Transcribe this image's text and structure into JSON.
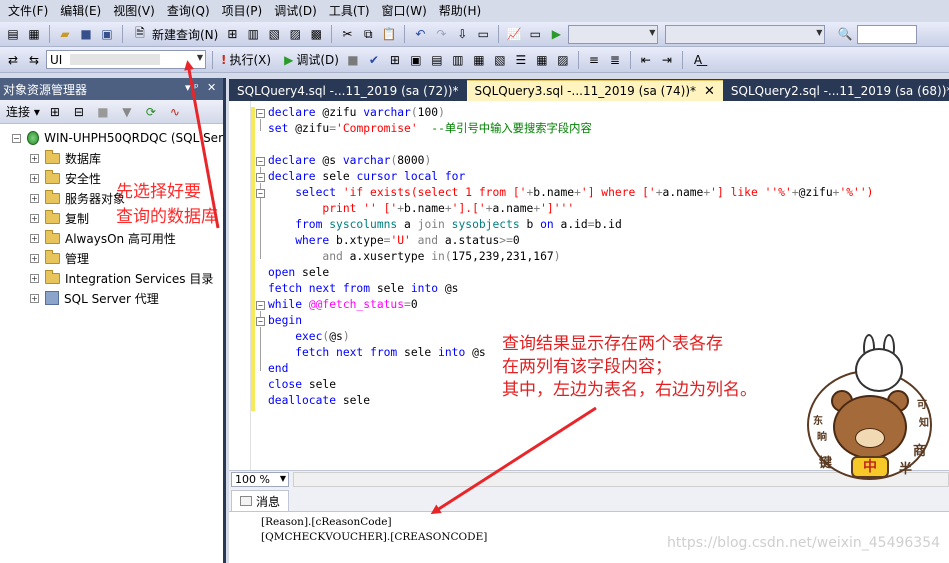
{
  "menu": [
    "文件(F)",
    "编辑(E)",
    "视图(V)",
    "查询(Q)",
    "项目(P)",
    "调试(D)",
    "工具(T)",
    "窗口(W)",
    "帮助(H)"
  ],
  "toolbar": {
    "new_query": "新建查询(N)",
    "database_combo": "UI",
    "execute": "执行(X)",
    "debug": "调试(D)"
  },
  "object_explorer": {
    "title": "对象资源管理器",
    "pin": "▾ ᵖ",
    "close": "✕",
    "connect": "连接",
    "server": "WIN-UHPH50QRDQC (SQL Ser",
    "nodes": [
      "数据库",
      "安全性",
      "服务器对象",
      "复制",
      "AlwaysOn 高可用性",
      "管理",
      "Integration Services 目录",
      "SQL Server 代理"
    ]
  },
  "tabs": [
    {
      "label": "SQLQuery4.sql -...11_2019 (sa (72))*"
    },
    {
      "label": "SQLQuery3.sql -...11_2019 (sa (74))*",
      "close": "✕"
    },
    {
      "label": "SQLQuery2.sql -...11_2019 (sa (68))*"
    }
  ],
  "code": {
    "l1a": "declare ",
    "l1b": "@zifu ",
    "l1c": "varchar",
    "l1d": "(",
    "l1e": "100",
    "l1f": ")",
    "l2a": "set ",
    "l2b": "@zifu",
    "l2c": "=",
    "l2d": "'Compromise'",
    "l2e": "  --单引号中输入要搜索字段内容",
    "l3a": "declare ",
    "l3b": "@s ",
    "l3c": "varchar",
    "l3d": "(",
    "l3e": "8000",
    "l3f": ")",
    "l4a": "declare ",
    "l4b": "sele ",
    "l4c": "cursor local for",
    "l5a": "    select ",
    "l5b": "'if exists(select 1 from ['",
    "l5c": "+",
    "l5d": "b.name",
    "l5e": "+",
    "l5f": "'] where ['",
    "l5g": "+",
    "l5h": "a.name",
    "l5i": "+",
    "l5j": "'] like ''%'",
    "l5k": "+",
    "l5l": "@zifu",
    "l5m": "+",
    "l5n": "'%'')",
    "l6a": "        print '' ['",
    "l6b": "+",
    "l6c": "b.name",
    "l6d": "+",
    "l6e": "'].['",
    "l6f": "+",
    "l6g": "a.name",
    "l6h": "+",
    "l6i": "']'''",
    "l7a": "    from ",
    "l7b": "syscolumns ",
    "l7c": "a ",
    "l7d": "join ",
    "l7e": "sysobjects ",
    "l7f": "b ",
    "l7g": "on ",
    "l7h": "a.id",
    "l7i": "=",
    "l7j": "b.id",
    "l8a": "    where ",
    "l8b": "b.xtype",
    "l8c": "=",
    "l8d": "'U' ",
    "l8e": "and ",
    "l8f": "a.status",
    "l8g": ">=",
    "l8h": "0",
    "l9a": "        and ",
    "l9b": "a.xusertype ",
    "l9c": "in",
    "l9d": "(",
    "l9e": "175,239,231,167",
    "l9f": ")",
    "l10a": "open ",
    "l10b": "sele",
    "l11a": "fetch next from ",
    "l11b": "sele ",
    "l11c": "into ",
    "l11d": "@s",
    "l12a": "while ",
    "l12b": "@@fetch_status",
    "l12c": "=",
    "l12d": "0",
    "l13a": "begin",
    "l14a": "    exec",
    "l14b": "(",
    "l14c": "@s",
    "l14d": ")",
    "l15a": "    fetch next from ",
    "l15b": "sele ",
    "l15c": "into ",
    "l15d": "@s",
    "l16a": "end",
    "l17a": "close ",
    "l17b": "sele",
    "l18a": "deallocate ",
    "l18b": "sele"
  },
  "zoom": "100 %",
  "results": {
    "tab": "消息",
    "lines": [
      "[Reason].[cReasonCode]",
      "[QMCHECKVOUCHER].[CREASONCODE]"
    ]
  },
  "annotations": {
    "left": [
      "先选择好要",
      "查询的数据库"
    ],
    "right": [
      "查询结果显示存在两个表各存",
      "在两列有该字段内容；",
      "其中，左边为表名，右边为列名。"
    ]
  },
  "sticker": {
    "bottom": "中",
    "chars": [
      "东",
      "晌",
      "可",
      "知",
      "键",
      "商",
      "半"
    ]
  },
  "watermark": "https://blog.csdn.net/weixin_45496354",
  "colors": {
    "title_bar": "#4d6082",
    "tab_strip": "#293955",
    "active_tab": "#fff4c0",
    "annotation": "#ff2a2a"
  }
}
